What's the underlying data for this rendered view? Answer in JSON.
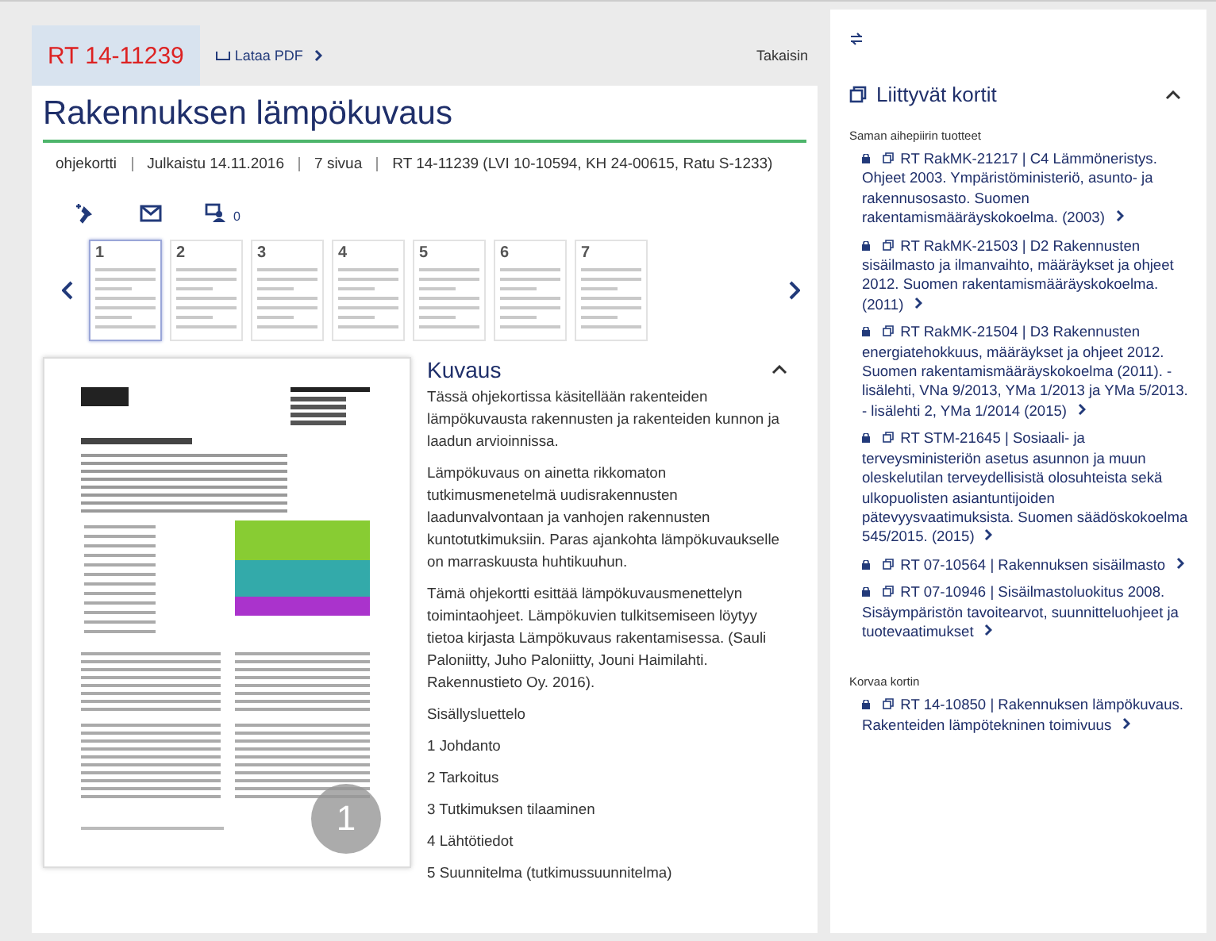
{
  "header": {
    "tabs": [
      {
        "label": "RT 14-11239",
        "selected": true
      }
    ],
    "pdf_link": "Lataa PDF",
    "back_link": "Takaisin"
  },
  "card": {
    "title": "Rakennuksen lämpökuvaus",
    "meta": [
      "ohjekortti",
      "Julkaistu 14.11.2016",
      "7 sivua",
      "RT 14-11239 (LVI 10-10594, KH 24-00615, Ratu S-1233)"
    ],
    "comment_count": "0",
    "thumbnails": [
      {
        "label": "1",
        "selected": true
      },
      {
        "label": "2",
        "selected": false
      },
      {
        "label": "3",
        "selected": false
      },
      {
        "label": "4",
        "selected": false
      },
      {
        "label": "5",
        "selected": false
      },
      {
        "label": "6",
        "selected": false
      },
      {
        "label": "7",
        "selected": false
      }
    ],
    "preview_page_badge": "1",
    "description": {
      "title": "Kuvaus",
      "expanded": true,
      "paragraphs": [
        "Tässä ohjekortissa käsitellään rakenteiden lämpökuvausta rakennusten ja rakenteiden kunnon ja laadun arvioinnissa.",
        "Lämpökuvaus on ainetta rikkomaton tutkimusmenetelmä uudisrakennusten laadunvalvontaan ja vanhojen rakennusten kuntotutkimuksiin. Paras ajankohta lämpökuvaukselle on marraskuusta huhtikuuhun.",
        "Tämä ohjekortti esittää lämpökuvausmenettelyn toimintaohjeet. Lämpökuvien tulkitsemiseen löytyy tietoa kirjasta Lämpökuvaus rakentamisessa. (Sauli Paloniitty, Juho Paloniitty, Jouni Haimilahti. Rakennustieto Oy. 2016).",
        "Sisällysluettelo",
        "1 Johdanto",
        "2 Tarkoitus",
        "3 Tutkimuksen tilaaminen",
        "4 Lähtötiedot",
        "5 Suunnitelma (tutkimussuunnitelma)"
      ]
    }
  },
  "related": {
    "title": "Liittyvät kortit",
    "expanded": true,
    "groups": [
      {
        "title": "Saman aihepiirin tuotteet",
        "items": [
          "RT RakMK-21217 | C4 Lämmöneristys. Ohjeet 2003. Ympäristöministeriö, asunto- ja rakennusosasto. Suomen rakentamismääräyskokoelma. (2003)",
          "RT RakMK-21503 | D2 Rakennusten sisäilmasto ja ilmanvaihto, määräykset ja ohjeet 2012. Suomen rakentamismääräyskokoelma. (2011)",
          "RT RakMK-21504 | D3 Rakennusten energiatehokkuus, määräykset ja ohjeet 2012. Suomen rakentamismääräyskokoelma (2011). - lisälehti, VNa 9/2013, YMa 1/2013 ja YMa 5/2013. - lisälehti 2, YMa 1/2014 (2015)",
          "RT STM-21645 | Sosiaali- ja terveysministeriön asetus asunnon ja muun oleskelutilan terveydellisistä olosuhteista sekä ulkopuolisten asiantuntijoiden pätevyysvaatimuksista. Suomen säädöskokoelma 545/2015. (2015)",
          "RT 07-10564 | Rakennuksen sisäilmasto",
          "RT 07-10946 | Sisäilmastoluokitus 2008. Sisäympäristön tavoitearvot, suunnitteluohjeet ja tuotevaatimukset"
        ]
      },
      {
        "title": "Korvaa kortin",
        "items": [
          "RT 14-10850 | Rakennuksen lämpökuvaus. Rakenteiden lämpötekninen toimivuus"
        ]
      }
    ]
  }
}
